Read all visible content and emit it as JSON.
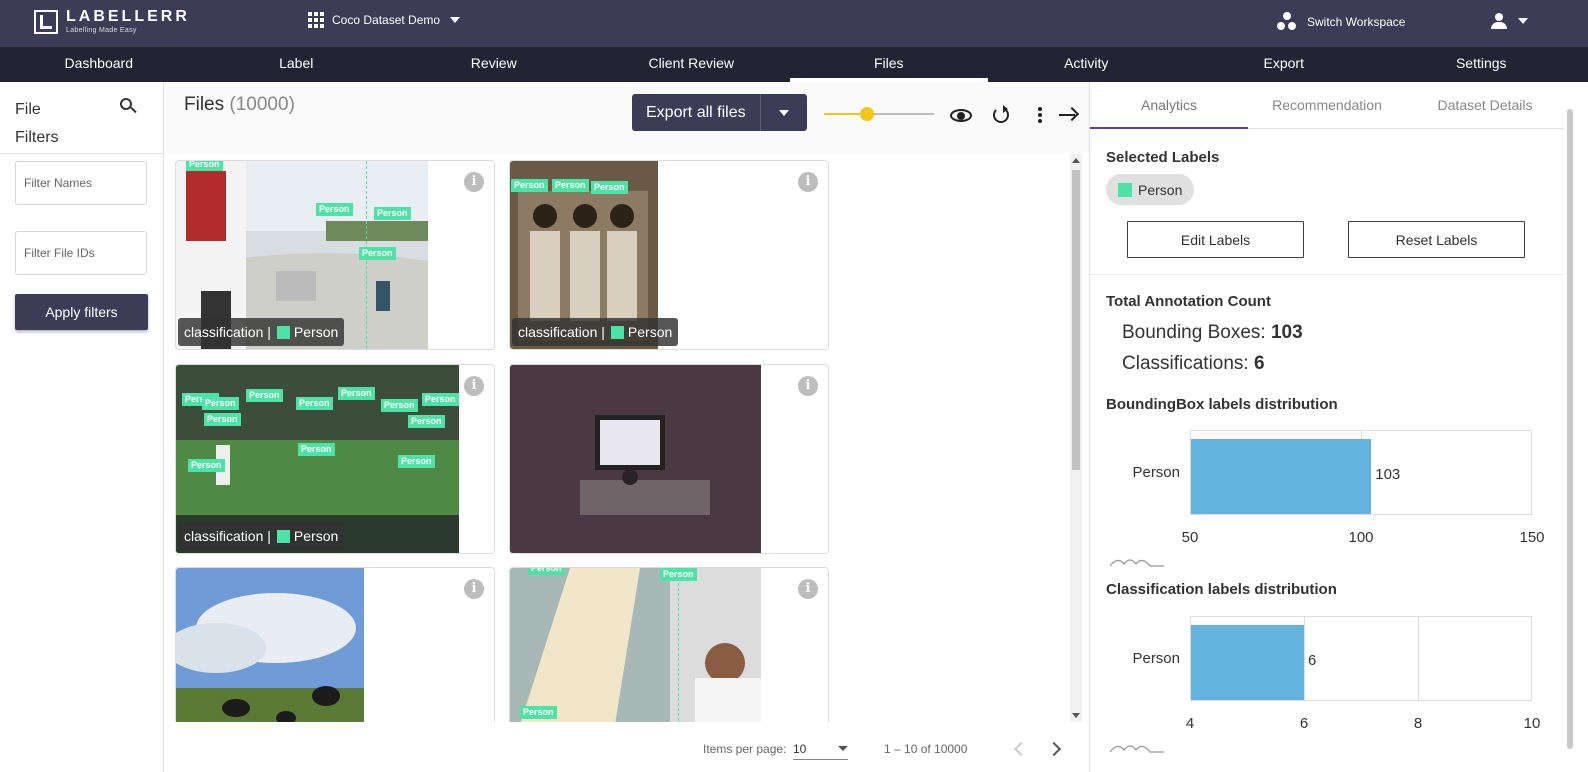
{
  "brand": {
    "name": "LABELLERR",
    "tagline": "Labelling Made Easy"
  },
  "topbar": {
    "project": "Coco Dataset Demo",
    "switch_workspace": "Switch Workspace"
  },
  "nav": {
    "tabs": [
      {
        "label": "Dashboard"
      },
      {
        "label": "Label"
      },
      {
        "label": "Review"
      },
      {
        "label": "Client Review"
      },
      {
        "label": "Files",
        "active": true
      },
      {
        "label": "Activity"
      },
      {
        "label": "Export"
      },
      {
        "label": "Settings"
      }
    ]
  },
  "filters": {
    "title": "File Filters",
    "names_placeholder": "Filter Names",
    "ids_placeholder": "Filter File IDs",
    "apply_label": "Apply filters"
  },
  "files": {
    "title": "Files",
    "count": "(10000)",
    "export_label": "Export all files",
    "thumbnail_size_fraction": 0.39,
    "cards": [
      {
        "classification_text": "classification |",
        "class_label": "Person",
        "box_labels": [
          "Person",
          "Person",
          "Person",
          "Person"
        ]
      },
      {
        "classification_text": "classification |",
        "class_label": "Person",
        "box_labels": [
          "Person",
          "Person",
          "Person"
        ]
      },
      {
        "classification_text": "classification |",
        "class_label": "Person",
        "box_labels": [
          "Person",
          "Person",
          "Person",
          "Person",
          "Person",
          "Person",
          "Person",
          "Person",
          "Person",
          "Person",
          "Person",
          "Person"
        ]
      },
      {
        "classification_text": "",
        "class_label": "",
        "box_labels": []
      },
      {
        "classification_text": "",
        "class_label": "",
        "box_labels": []
      },
      {
        "classification_text": "",
        "class_label": "",
        "box_labels": [
          "Person",
          "Person",
          "Person"
        ]
      }
    ],
    "info_glyph": "i"
  },
  "paginator": {
    "items_per_page_label": "Items per page:",
    "items_per_page": "10",
    "range": "1 – 10 of 10000"
  },
  "analytics": {
    "tabs": [
      {
        "label": "Analytics",
        "active": true
      },
      {
        "label": "Recommendation"
      },
      {
        "label": "Dataset Details"
      }
    ],
    "selected_labels_title": "Selected Labels",
    "selected_chip": "Person",
    "edit_labels": "Edit Labels",
    "reset_labels": "Reset Labels",
    "total_title": "Total Annotation Count",
    "bbox_label": "Bounding Boxes:",
    "bbox_count": "103",
    "cls_label": "Classifications:",
    "cls_count": "6",
    "bbox_dist_title": "BoundingBox labels distribution",
    "cls_dist_title": "Classification labels distribution"
  },
  "chart_data": [
    {
      "type": "bar",
      "orientation": "horizontal",
      "title": "BoundingBox labels distribution",
      "categories": [
        "Person"
      ],
      "values": [
        103
      ],
      "xlim": [
        50,
        150
      ],
      "ticks": [
        "50",
        "100",
        "150"
      ],
      "value_labels": [
        "103"
      ],
      "grid": true,
      "color": "#63b3de"
    },
    {
      "type": "bar",
      "orientation": "horizontal",
      "title": "Classification labels distribution",
      "categories": [
        "Person"
      ],
      "values": [
        6
      ],
      "xlim": [
        4,
        10
      ],
      "ticks": [
        "4",
        "6",
        "8",
        "10"
      ],
      "value_labels": [
        "6"
      ],
      "grid": true,
      "color": "#63b3de"
    }
  ],
  "colors": {
    "topbar": "#3d3c56",
    "navbar": "#242333",
    "label_green": "#4ee3a6",
    "bar_blue": "#63b3de",
    "slider_yellow": "#f5c518",
    "tab_accent": "#5b3fb0"
  },
  "icons": {
    "apps": "grid-icon",
    "workspace": "workspace-icon",
    "user": "user-icon",
    "search": "zoom-icon",
    "visibility": "eye-icon",
    "refresh": "refresh-icon",
    "more": "more-vert-icon",
    "collapse": "arrow-right-icon",
    "chart_toggle": "wave-icon"
  }
}
